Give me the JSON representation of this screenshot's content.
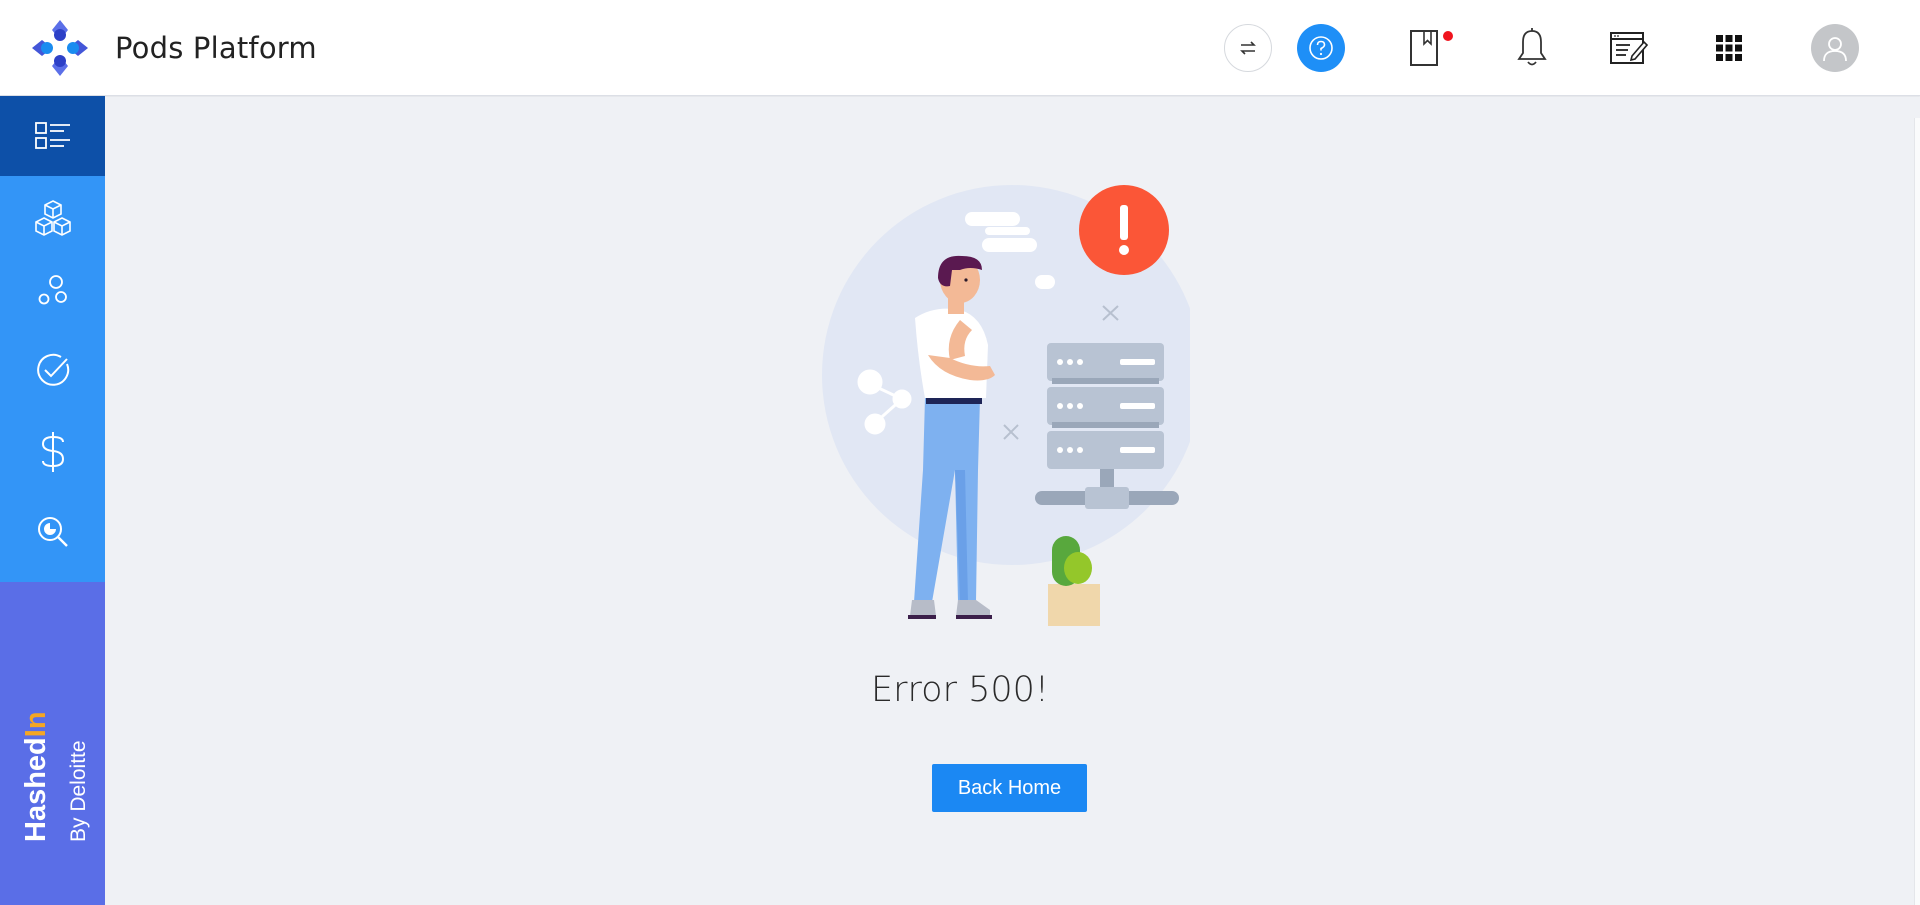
{
  "app": {
    "title": "Pods Platform"
  },
  "header": {
    "icons": [
      "swap-icon",
      "help-icon",
      "bookmark-icon",
      "bell-icon",
      "notes-icon",
      "apps-grid-icon",
      "user-avatar-icon"
    ],
    "accent": "#1e8ff7",
    "notification_dot_color": "#f0141e"
  },
  "sidebar": {
    "background": "#3395f7",
    "active_background": "#0d50a8",
    "items": [
      {
        "icon": "list-icon",
        "active": true
      },
      {
        "icon": "cubes-icon",
        "active": false
      },
      {
        "icon": "bubbles-icon",
        "active": false
      },
      {
        "icon": "check-circle-icon",
        "active": false
      },
      {
        "icon": "dollar-icon",
        "active": false
      },
      {
        "icon": "search-analytics-icon",
        "active": false
      }
    ],
    "brand": {
      "name_part1": "Hashed",
      "name_part2": "In",
      "tagline": "By Deloitte"
    }
  },
  "main": {
    "illustration": "server-error-illustration",
    "error_title": "Error 500!",
    "back_button_label": "Back Home"
  }
}
